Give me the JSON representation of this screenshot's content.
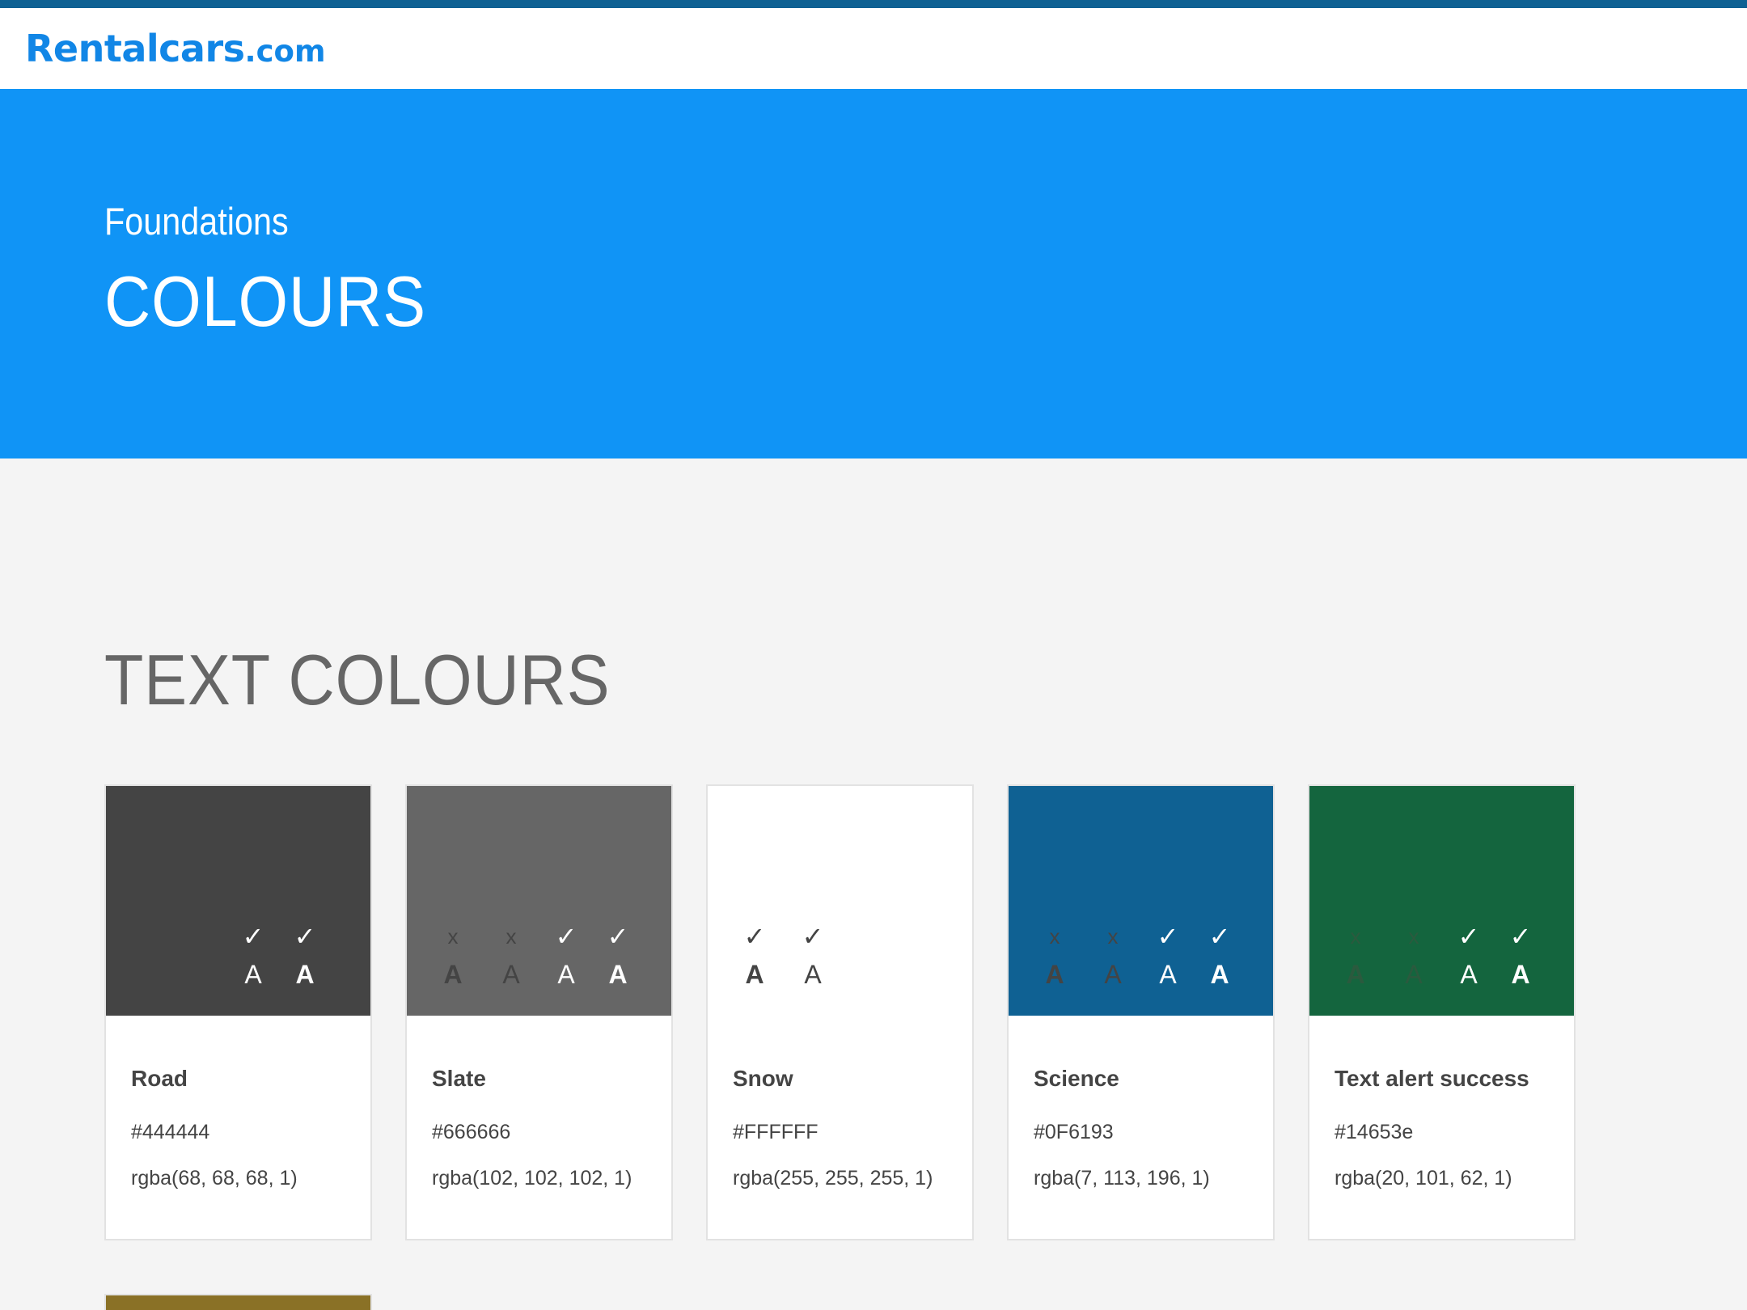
{
  "header": {
    "logo_main": "Rentalcars",
    "logo_tld": ".com"
  },
  "hero": {
    "eyebrow": "Foundations",
    "title": "COLOURS"
  },
  "section": {
    "title": "TEXT COLOURS"
  },
  "colors": {
    "brand": "#1186e6",
    "hero_bg": "#1094f6",
    "top_stripe": "#0f6193",
    "page_bg": "#f4f4f4"
  },
  "icons": {
    "pass": "check-mark-icon",
    "fail": "x-mark-icon"
  },
  "cards": [
    {
      "name": "Road",
      "hex": "#444444",
      "rgba": "rgba(68, 68, 68, 1)",
      "swatch": "#444444",
      "grades": [
        {
          "mark": "✓",
          "letter": "A",
          "mark_color": "#ffffff",
          "letter_color": "#ffffff",
          "bold": false
        },
        {
          "mark": "✓",
          "letter": "A",
          "mark_color": "#ffffff",
          "letter_color": "#ffffff",
          "bold": true
        }
      ]
    },
    {
      "name": "Slate",
      "hex": "#666666",
      "rgba": "rgba(102, 102, 102, 1)",
      "swatch": "#666666",
      "grades": [
        {
          "mark": "x",
          "letter": "A",
          "mark_color": "#444444",
          "letter_color": "#444444",
          "bold": true
        },
        {
          "mark": "x",
          "letter": "A",
          "mark_color": "#444444",
          "letter_color": "#444444",
          "bold": false
        },
        {
          "mark": "✓",
          "letter": "A",
          "mark_color": "#ffffff",
          "letter_color": "#ffffff",
          "bold": false
        },
        {
          "mark": "✓",
          "letter": "A",
          "mark_color": "#ffffff",
          "letter_color": "#ffffff",
          "bold": true
        }
      ]
    },
    {
      "name": "Snow",
      "hex": "#FFFFFF",
      "rgba": "rgba(255, 255, 255, 1)",
      "swatch": "#ffffff",
      "grades": [
        {
          "mark": "✓",
          "letter": "A",
          "mark_color": "#444444",
          "letter_color": "#444444",
          "bold": true
        },
        {
          "mark": "✓",
          "letter": "A",
          "mark_color": "#444444",
          "letter_color": "#444444",
          "bold": false
        }
      ]
    },
    {
      "name": "Science",
      "hex": "#0F6193",
      "rgba": "rgba(7, 113, 196, 1)",
      "swatch": "#0f6193",
      "grades": [
        {
          "mark": "x",
          "letter": "A",
          "mark_color": "#444444",
          "letter_color": "#444444",
          "bold": true
        },
        {
          "mark": "x",
          "letter": "A",
          "mark_color": "#444444",
          "letter_color": "#444444",
          "bold": false
        },
        {
          "mark": "✓",
          "letter": "A",
          "mark_color": "#ffffff",
          "letter_color": "#ffffff",
          "bold": false
        },
        {
          "mark": "✓",
          "letter": "A",
          "mark_color": "#ffffff",
          "letter_color": "#ffffff",
          "bold": true
        }
      ]
    },
    {
      "name": "Text alert success",
      "hex": "#14653e",
      "rgba": "rgba(20, 101, 62, 1)",
      "swatch": "#14653e",
      "grades": [
        {
          "mark": "x",
          "letter": "A",
          "mark_color": "#2b5a3e",
          "letter_color": "#2b5a3e",
          "bold": true
        },
        {
          "mark": "x",
          "letter": "A",
          "mark_color": "#2b5a3e",
          "letter_color": "#2b5a3e",
          "bold": false
        },
        {
          "mark": "✓",
          "letter": "A",
          "mark_color": "#ffffff",
          "letter_color": "#ffffff",
          "bold": false
        },
        {
          "mark": "✓",
          "letter": "A",
          "mark_color": "#ffffff",
          "letter_color": "#ffffff",
          "bold": true
        }
      ]
    }
  ],
  "next_card": {
    "swatch": "#8a7126"
  }
}
